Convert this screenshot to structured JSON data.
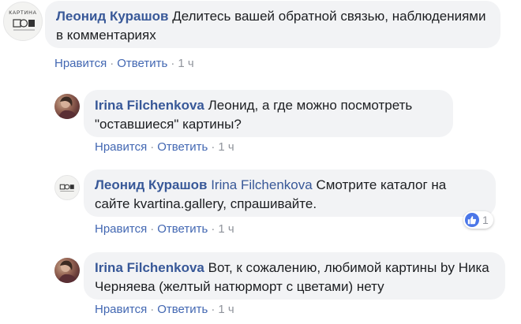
{
  "colors": {
    "author": "#385898",
    "action_link": "#4267b2",
    "bubble_bg": "#f2f3f5",
    "muted": "#90949c",
    "like_blue": "#4a76e8"
  },
  "comments": [
    {
      "author": "Леонид Курашов",
      "text": "Делитесь вашей обратной связью, наблюдениями в комментариях",
      "avatar_icon": "gallery-logo",
      "avatar_text": "КАРТИНА",
      "like_label": "Нравится",
      "reply_label": "Ответить",
      "time": "1 ч"
    },
    {
      "author": "Irina Filchenkova",
      "text": "Леонид, а где можно посмотреть \"оставшиеся\" картины?",
      "avatar_icon": "user-photo",
      "like_label": "Нравится",
      "reply_label": "Ответить",
      "time": "1 ч"
    },
    {
      "author": "Леонид Курашов",
      "mention": "Irina Filchenkova",
      "text": "Смотрите каталог на сайте kvartina.gallery, спрашивайте.",
      "avatar_icon": "gallery-logo",
      "like_label": "Нравится",
      "reply_label": "Ответить",
      "time": "1 ч",
      "reaction": {
        "icon": "thumbs-up-icon",
        "count": "1"
      }
    },
    {
      "author": "Irina Filchenkova",
      "text": "Вот, к сожалению, любимой картины by Ника Черняева (желтый натюрморт с цветами) нету",
      "avatar_icon": "user-photo",
      "like_label": "Нравится",
      "reply_label": "Ответить",
      "time": "1 ч"
    }
  ]
}
